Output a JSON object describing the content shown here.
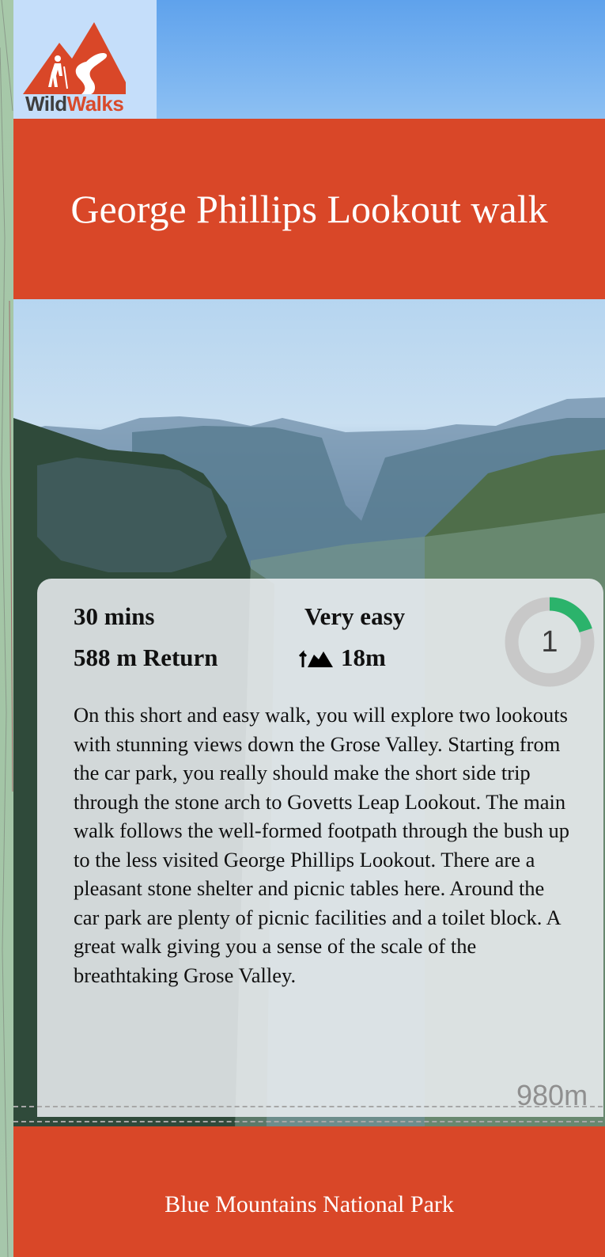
{
  "brand": {
    "logo_word_1": "Wild",
    "logo_word_2": "Walks"
  },
  "walk": {
    "title": "George Phillips Lookout walk",
    "duration": "30 mins",
    "difficulty": "Very easy",
    "distance": "588 m Return",
    "elevation_gain": "18m",
    "elevation_icon": "elevation-gain-icon",
    "grade": "1",
    "grade_fraction": 0.2,
    "description": "On this short and easy walk, you will explore two lookouts with stunning views down the Grose Valley. Starting from the car park, you really should make the short side trip through the stone arch to Govetts Leap Lookout. The main walk follows the well-formed footpath through the bush up to the less visited George Phillips Lookout. There are a pleasant stone shelter and picnic tables here. Around the car park are plenty of picnic facilities and a toilet block. A great walk giving you a sense of the scale of the breathtaking Grose Valley."
  },
  "profile": {
    "max_altitude": "980m"
  },
  "footer": {
    "park": "Blue Mountains National Park"
  },
  "colors": {
    "brand_orange": "#d94728",
    "grade_green": "#2bb36b",
    "grade_track": "#c8c8c8"
  }
}
